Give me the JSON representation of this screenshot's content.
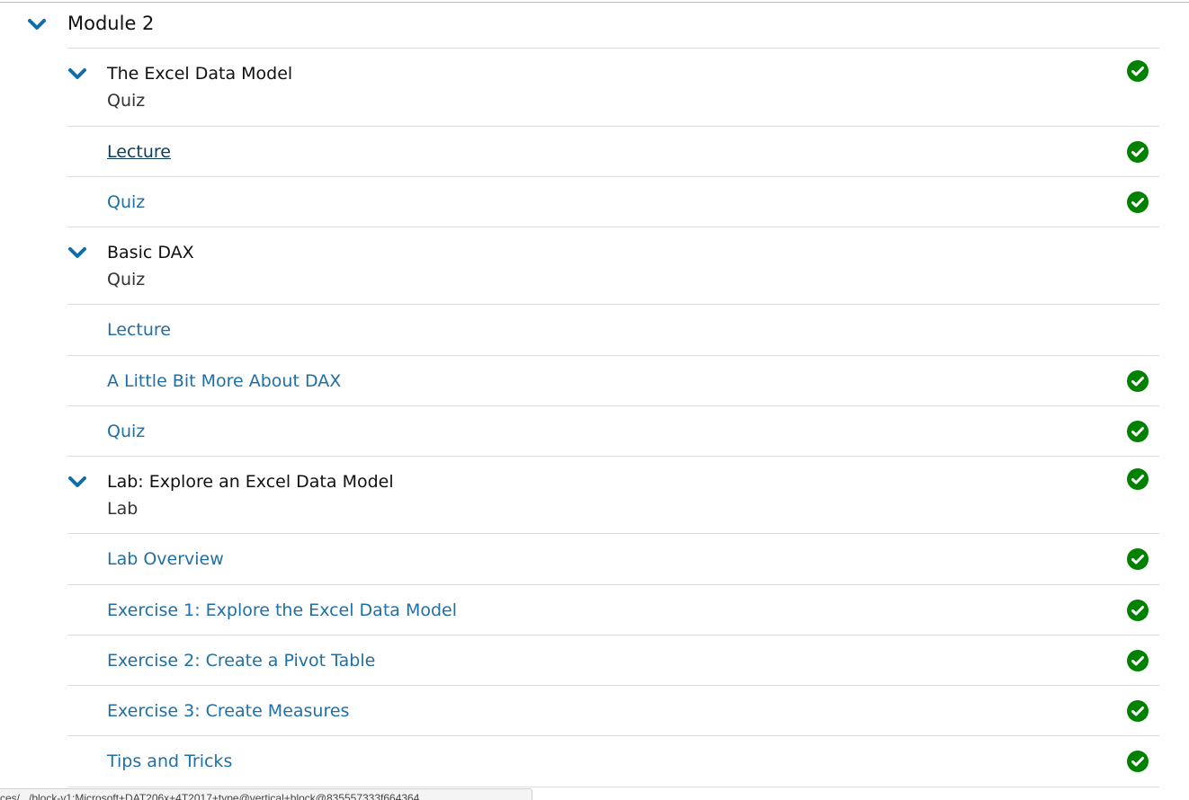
{
  "module": {
    "title": "Module 2"
  },
  "subsections": [
    {
      "title": "The Excel Data Model",
      "type": "Quiz",
      "completed": true,
      "units": [
        {
          "label": "Lecture",
          "completed": true,
          "active": true
        },
        {
          "label": "Quiz",
          "completed": true,
          "active": false
        }
      ]
    },
    {
      "title": "Basic DAX",
      "type": "Quiz",
      "completed": false,
      "units": [
        {
          "label": "Lecture",
          "completed": false,
          "active": false
        },
        {
          "label": "A Little Bit More About DAX",
          "completed": true,
          "active": false
        },
        {
          "label": "Quiz",
          "completed": true,
          "active": false
        }
      ]
    },
    {
      "title": "Lab: Explore an Excel Data Model",
      "type": "Lab",
      "completed": true,
      "units": [
        {
          "label": "Lab Overview",
          "completed": true,
          "active": false
        },
        {
          "label": "Exercise 1: Explore the Excel Data Model",
          "completed": true,
          "active": false
        },
        {
          "label": "Exercise 2: Create a Pivot Table",
          "completed": true,
          "active": false
        },
        {
          "label": "Exercise 3: Create Measures",
          "completed": true,
          "active": false
        },
        {
          "label": "Tips and Tricks",
          "completed": true,
          "active": false
        }
      ]
    }
  ],
  "status_bar": {
    "url": "ces/.../block-v1:Microsoft+DAT206x+4T2017+type@vertical+block@835557333f664364"
  },
  "icons": {
    "chevron": "chevron-down-icon",
    "check": "check-circle-icon"
  },
  "colors": {
    "link": "#1f6fa6",
    "active_link": "#0b3c5d",
    "chevron": "#0d6ea8",
    "complete": "#008100"
  }
}
